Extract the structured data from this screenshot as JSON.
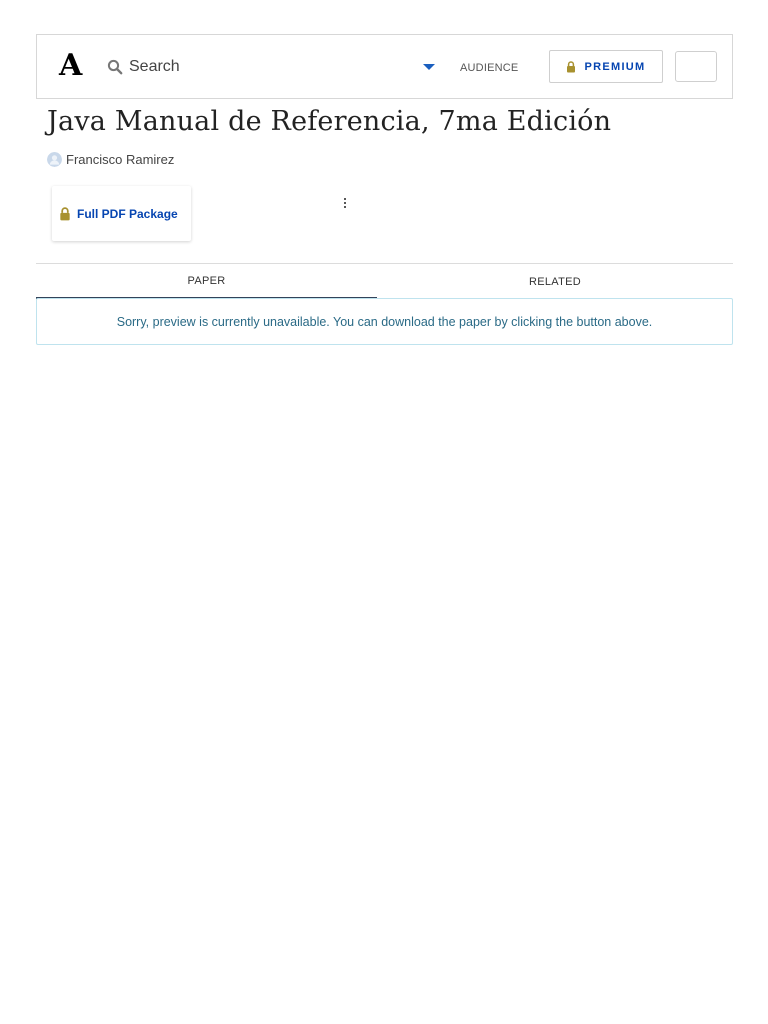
{
  "header": {
    "logo": "A",
    "search": {
      "placeholder": "Search",
      "value": ""
    },
    "audience_label": "AUDIENCE",
    "premium_label": "PREMIUM"
  },
  "paper": {
    "title": "Java Manual de Referencia, 7ma Edición",
    "author": "Francisco Ramirez",
    "download_label": "Full PDF Package"
  },
  "tabs": [
    {
      "label": "PAPER",
      "active": true
    },
    {
      "label": "RELATED",
      "active": false
    }
  ],
  "notice": "Sorry, preview is currently unavailable. You can download the paper by clicking the button above.",
  "colors": {
    "link_blue": "#0645b1",
    "lock_gold": "#a8912f",
    "tab_underline": "#33435a",
    "notice_border": "#bfe3ee",
    "notice_text": "#2a6a86"
  },
  "icons": [
    "search-icon",
    "caret-down-icon",
    "lock-icon",
    "avatar-icon",
    "more-vertical-icon"
  ]
}
